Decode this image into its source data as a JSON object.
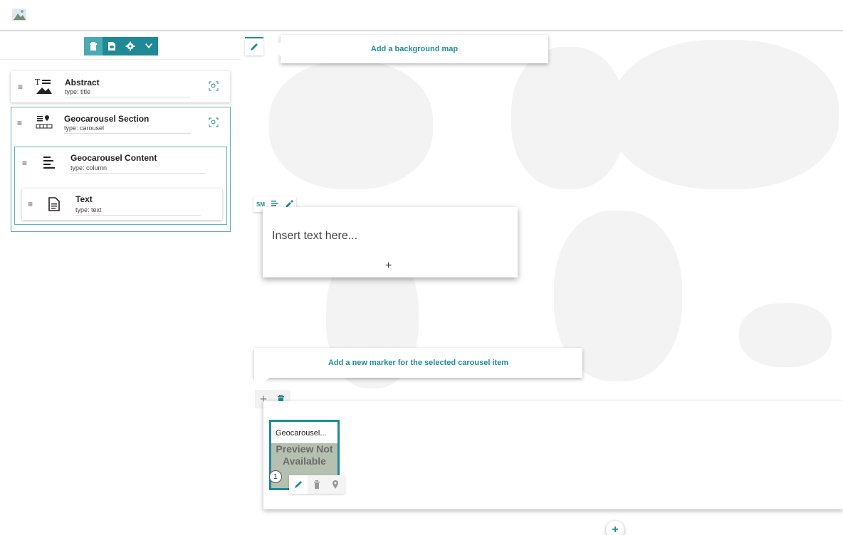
{
  "header": {
    "logo_icon": "app-logo-icon"
  },
  "toolbar": {
    "buttons": [
      {
        "icon": "trash-icon"
      },
      {
        "icon": "preview-icon"
      },
      {
        "icon": "gear-icon"
      },
      {
        "icon": "chevron-down-icon"
      }
    ],
    "accent": "#1f8a96"
  },
  "tree": {
    "nodes": [
      {
        "title": "Abstract",
        "type": "type: title"
      },
      {
        "title": "Geocarousel Section",
        "type": "type: carousel"
      },
      {
        "title": "Geocarousel Content",
        "type": "type: column"
      },
      {
        "title": "Text",
        "type": "type: text"
      }
    ]
  },
  "map": {
    "background_prompt": "Add a background map",
    "text_tools": {
      "size_label": "SM"
    },
    "text_placeholder": "Insert text here...",
    "add_label": "+",
    "marker_prompt": "Add a new marker for the selected carousel item",
    "carousel": {
      "item_title": "Geocarousel...",
      "preview_text": "Preview Not Available",
      "item_number": "1"
    }
  }
}
